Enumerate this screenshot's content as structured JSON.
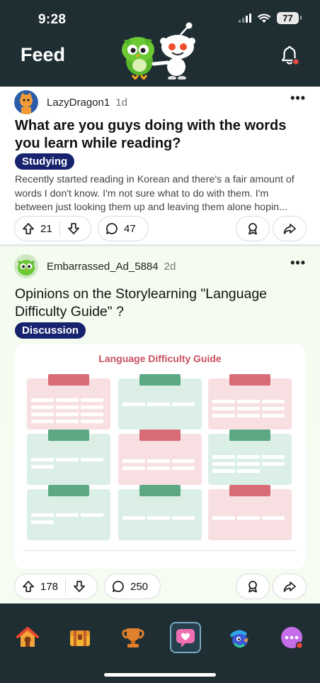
{
  "status_bar": {
    "time": "9:28",
    "battery": "77"
  },
  "header": {
    "title": "Feed"
  },
  "posts": [
    {
      "username": "LazyDragon1",
      "time": "1d",
      "title": "What are you guys doing with the words you learn while reading?",
      "tag": "Studying",
      "excerpt": "Recently started reading in Korean and there's a fair amount of words I don't know. I'm not sure what to do with them. I'm between just looking them up and leaving them alone hopin...",
      "upvotes": "21",
      "comments": "47"
    },
    {
      "username": "Embarrassed_Ad_5884",
      "time": "2d",
      "title": "Opinions on the Storylearning \"Language Difficulty Guide\" ?",
      "tag": "Discussion",
      "image_title": "Language Difficulty Guide",
      "upvotes": "178",
      "comments": "250"
    }
  ],
  "tabs": [
    "home",
    "quests",
    "leaderboard",
    "feed",
    "shop",
    "more"
  ],
  "colors": {
    "dark": "#1f2e33",
    "tag": "#17236e",
    "guide_accent": "#c75060"
  }
}
